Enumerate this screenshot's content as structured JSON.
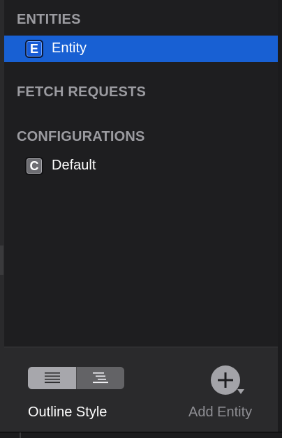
{
  "sidebar": {
    "sections": {
      "entities": {
        "header": "ENTITIES"
      },
      "fetch_requests": {
        "header": "FETCH REQUESTS"
      },
      "configurations": {
        "header": "CONFIGURATIONS"
      }
    },
    "entity_item": {
      "badge": "E",
      "label": "Entity",
      "selected": true
    },
    "configuration_item": {
      "badge": "C",
      "label": "Default"
    }
  },
  "bottom_bar": {
    "editor_style_control": {
      "options": [
        "outline-style",
        "graph-style"
      ],
      "selected": "outline-style",
      "label": "Outline Style"
    },
    "add_entity": {
      "icon": "plus-circle-icon",
      "label": "Add Entity"
    }
  },
  "colors": {
    "selection": "#1860d3",
    "entity_badge": "#175bd6",
    "config_badge": "#6d6d72",
    "background": "#1e1e20",
    "toolbar": "#2a2a2c",
    "section_header": "#9b9ba0"
  }
}
